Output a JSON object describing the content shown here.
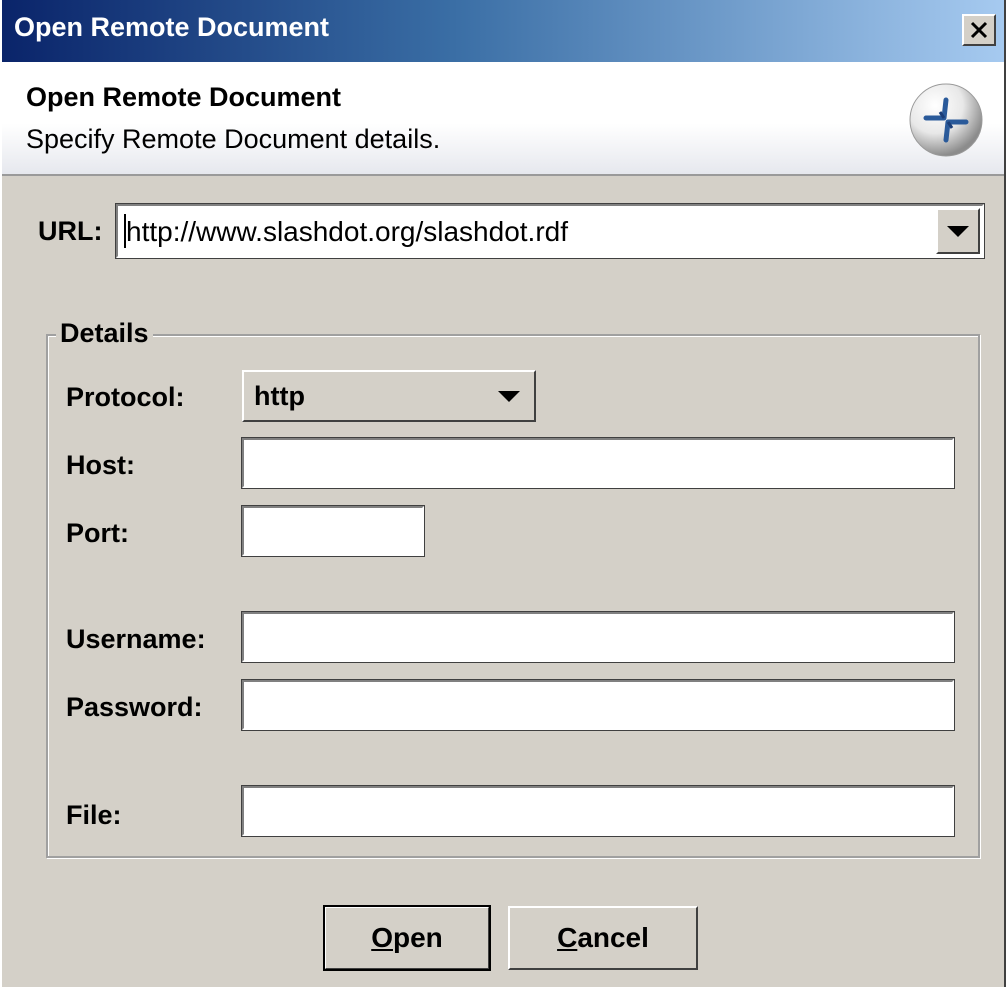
{
  "window": {
    "title": "Open Remote Document",
    "close_glyph": "✕"
  },
  "banner": {
    "heading": "Open Remote Document",
    "subheading": "Specify Remote Document details.",
    "icon": "remote-document-icon"
  },
  "url": {
    "label": "URL:",
    "value": "http://www.slashdot.org/slashdot.rdf"
  },
  "details": {
    "legend": "Details",
    "protocol": {
      "label": "Protocol:",
      "value": "http"
    },
    "host": {
      "label": "Host:",
      "value": ""
    },
    "port": {
      "label": "Port:",
      "value": ""
    },
    "username": {
      "label": "Username:",
      "value": ""
    },
    "password": {
      "label": "Password:",
      "value": ""
    },
    "file": {
      "label": "File:",
      "value": ""
    }
  },
  "buttons": {
    "open": {
      "mnemonic": "O",
      "rest": "pen"
    },
    "cancel": {
      "mnemonic": "C",
      "rest": "ancel"
    }
  },
  "colors": {
    "titlebar_start": "#0a246a",
    "titlebar_end": "#a6caf0",
    "dialog_bg": "#d4d0c8"
  }
}
